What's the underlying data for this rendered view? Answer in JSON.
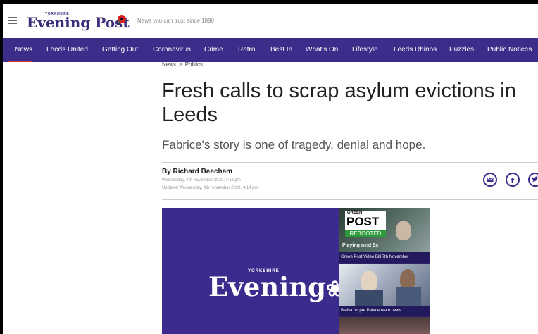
{
  "header": {
    "logo_small": "YORKSHIRE",
    "logo": "Evening Post",
    "tagline": "News you can trust since 1890"
  },
  "nav": {
    "items": [
      {
        "label": "News",
        "active": true
      },
      {
        "label": "Leeds United"
      },
      {
        "label": "Getting Out"
      },
      {
        "label": "Coronavirus"
      },
      {
        "label": "Crime"
      },
      {
        "label": "Retro"
      },
      {
        "label": "Best In"
      },
      {
        "label": "What's On"
      },
      {
        "label": "Lifestyle"
      },
      {
        "label": "Leeds Rhinos"
      },
      {
        "label": "Puzzles"
      },
      {
        "label": "Public Notices"
      }
    ],
    "accent_color": "#3b2e8a",
    "active_color": "#e03a3a"
  },
  "article": {
    "breadcrumb": [
      "News",
      "Politics"
    ],
    "breadcrumb_sep": ">",
    "headline": "Fresh calls to scrap asylum evictions in Leeds",
    "standfirst": "Fabrice's story is one of tragedy, denial and hope.",
    "author": "By Richard Beecham",
    "published": "Wednesday, 4th November 2020, 4:11 pm",
    "updated": "Updated Wednesday, 4th November 2020, 4:14 pm",
    "share_icons": [
      "email-icon",
      "facebook-icon",
      "twitter-icon"
    ]
  },
  "video": {
    "logo_small": "YORKSHIRE",
    "logo": "Evening",
    "playlist": [
      {
        "thumb_top": "GREEN",
        "thumb_title": "POST",
        "thumb_badge": "REBOOTED",
        "overlay": "Playing next 5s",
        "caption": "Green Post Video Bill 7th November"
      },
      {
        "caption": "Bielsa on pre Palace team news"
      },
      {
        "caption": ""
      }
    ]
  }
}
